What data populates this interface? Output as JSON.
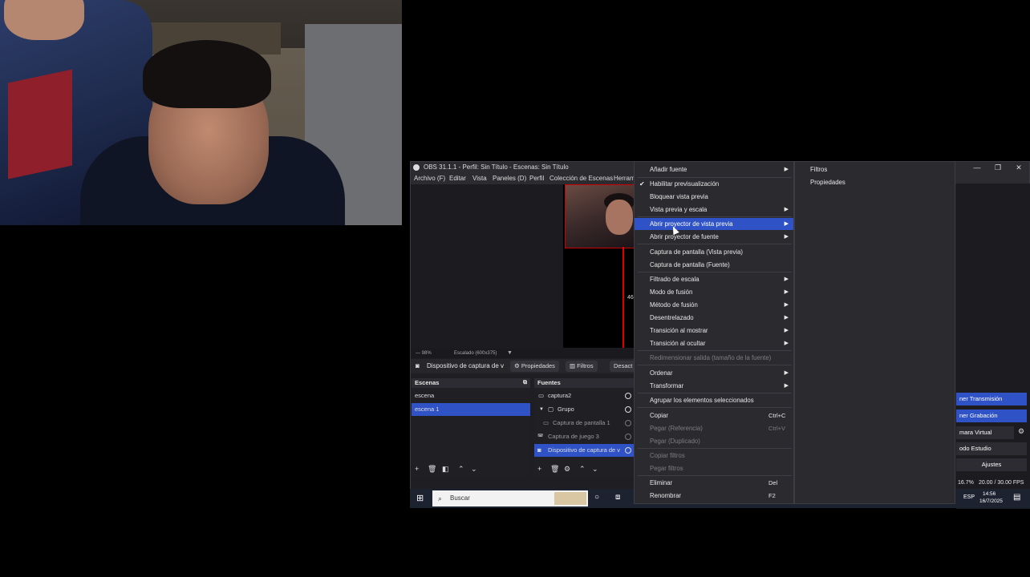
{
  "window": {
    "title": "OBS 31.1.1 - Perfil: Sin Título - Escenas: Sin Título",
    "controls": [
      "—",
      "❐",
      "✕"
    ]
  },
  "menubar": [
    "Archivo (F)",
    "Editar",
    "Vista",
    "Paneles (D)",
    "Perfil",
    "Colección de Escenas",
    "Herram"
  ],
  "preview": {
    "dimension_label": "46",
    "status_left": "— 98%",
    "status_scaled": "Escalado (600x375)"
  },
  "source_bar": {
    "source_name": "Dispositivo de captura de v",
    "properties_label": "Propiedades",
    "filters_label": "Filtros",
    "deactivate_label": "Desact"
  },
  "scenes": {
    "header": "Escenas",
    "items": [
      {
        "label": "escena",
        "selected": false
      },
      {
        "label": "escena 1",
        "selected": true
      }
    ]
  },
  "sources": {
    "header": "Fuentes",
    "items": [
      {
        "label": "captura2",
        "icon": "monitor-icon",
        "indent": 0,
        "selected": false
      },
      {
        "label": "Grupo",
        "icon": "folder-icon",
        "indent": 0,
        "selected": false
      },
      {
        "label": "Captura de pantalla 1",
        "icon": "monitor-icon",
        "indent": 1,
        "selected": false
      },
      {
        "label": "Captura de juego 3",
        "icon": "gamepad-icon",
        "indent": 0,
        "selected": false
      },
      {
        "label": "Dispositivo de captura de v",
        "icon": "camera-icon",
        "indent": 0,
        "selected": true
      }
    ]
  },
  "controls": {
    "start_streaming": "ner Transmisión",
    "start_recording": "ner Grabación",
    "virtual_camera": "mara Virtual",
    "studio_mode": "odo Estudio",
    "settings": "Ajustes",
    "stats": "16.7%",
    "fps": "20.00 / 30.00 FPS"
  },
  "taskbar": {
    "search_placeholder": "Buscar",
    "language": "ESP",
    "time": "14:56",
    "date": "16/7/2025"
  },
  "context_menu": {
    "items": [
      {
        "label": "Añadir fuente",
        "submenu": true,
        "checked": false,
        "disabled": false,
        "highlighted": false,
        "shortcut": ""
      },
      {
        "label": "Habilitar previsualización",
        "submenu": false,
        "checked": true,
        "disabled": false,
        "highlighted": false,
        "shortcut": ""
      },
      {
        "label": "Bloquear vista previa",
        "submenu": false,
        "checked": false,
        "disabled": false,
        "highlighted": false,
        "shortcut": ""
      },
      {
        "label": "Vista previa y escala",
        "submenu": true,
        "checked": false,
        "disabled": false,
        "highlighted": false,
        "shortcut": ""
      },
      {
        "label": "Abrir proyector de vista previa",
        "submenu": true,
        "checked": false,
        "disabled": false,
        "highlighted": true,
        "shortcut": ""
      },
      {
        "label": "Abrir proyector de fuente",
        "submenu": true,
        "checked": false,
        "disabled": false,
        "highlighted": false,
        "shortcut": ""
      },
      {
        "label": "Captura de pantalla (Vista previa)",
        "submenu": false,
        "checked": false,
        "disabled": false,
        "highlighted": false,
        "shortcut": ""
      },
      {
        "label": "Captura de pantalla (Fuente)",
        "submenu": false,
        "checked": false,
        "disabled": false,
        "highlighted": false,
        "shortcut": ""
      },
      {
        "label": "Filtrado de escala",
        "submenu": true,
        "checked": false,
        "disabled": false,
        "highlighted": false,
        "shortcut": ""
      },
      {
        "label": "Modo de fusión",
        "submenu": true,
        "checked": false,
        "disabled": false,
        "highlighted": false,
        "shortcut": ""
      },
      {
        "label": "Método de fusión",
        "submenu": true,
        "checked": false,
        "disabled": false,
        "highlighted": false,
        "shortcut": ""
      },
      {
        "label": "Desentrelazado",
        "submenu": true,
        "checked": false,
        "disabled": false,
        "highlighted": false,
        "shortcut": ""
      },
      {
        "label": "Transición al mostrar",
        "submenu": true,
        "checked": false,
        "disabled": false,
        "highlighted": false,
        "shortcut": ""
      },
      {
        "label": "Transición al ocultar",
        "submenu": true,
        "checked": false,
        "disabled": false,
        "highlighted": false,
        "shortcut": ""
      },
      {
        "label": "Redimensionar salida (tamaño de la fuente)",
        "submenu": false,
        "checked": false,
        "disabled": true,
        "highlighted": false,
        "shortcut": ""
      },
      {
        "label": "Ordenar",
        "submenu": true,
        "checked": false,
        "disabled": false,
        "highlighted": false,
        "shortcut": ""
      },
      {
        "label": "Transformar",
        "submenu": true,
        "checked": false,
        "disabled": false,
        "highlighted": false,
        "shortcut": ""
      },
      {
        "label": "Agrupar los elementos seleccionados",
        "submenu": false,
        "checked": false,
        "disabled": false,
        "highlighted": false,
        "shortcut": ""
      },
      {
        "label": "Copiar",
        "submenu": false,
        "checked": false,
        "disabled": false,
        "highlighted": false,
        "shortcut": "Ctrl+C"
      },
      {
        "label": "Pegar (Referencia)",
        "submenu": false,
        "checked": false,
        "disabled": true,
        "highlighted": false,
        "shortcut": "Ctrl+V"
      },
      {
        "label": "Pegar (Duplicado)",
        "submenu": false,
        "checked": false,
        "disabled": true,
        "highlighted": false,
        "shortcut": ""
      },
      {
        "label": "Copiar filtros",
        "submenu": false,
        "checked": false,
        "disabled": true,
        "highlighted": false,
        "shortcut": ""
      },
      {
        "label": "Pegar filtros",
        "submenu": false,
        "checked": false,
        "disabled": true,
        "highlighted": false,
        "shortcut": ""
      },
      {
        "label": "Eliminar",
        "submenu": false,
        "checked": false,
        "disabled": false,
        "highlighted": false,
        "shortcut": "Del"
      },
      {
        "label": "Renombrar",
        "submenu": false,
        "checked": false,
        "disabled": false,
        "highlighted": false,
        "shortcut": "F2"
      }
    ]
  },
  "submenu": {
    "items": [
      "Filtros",
      "Propiedades"
    ]
  },
  "colors": {
    "accent": "#2f53c7",
    "menu_bg": "#2b2b2f",
    "window_bg": "#1f1f23"
  }
}
